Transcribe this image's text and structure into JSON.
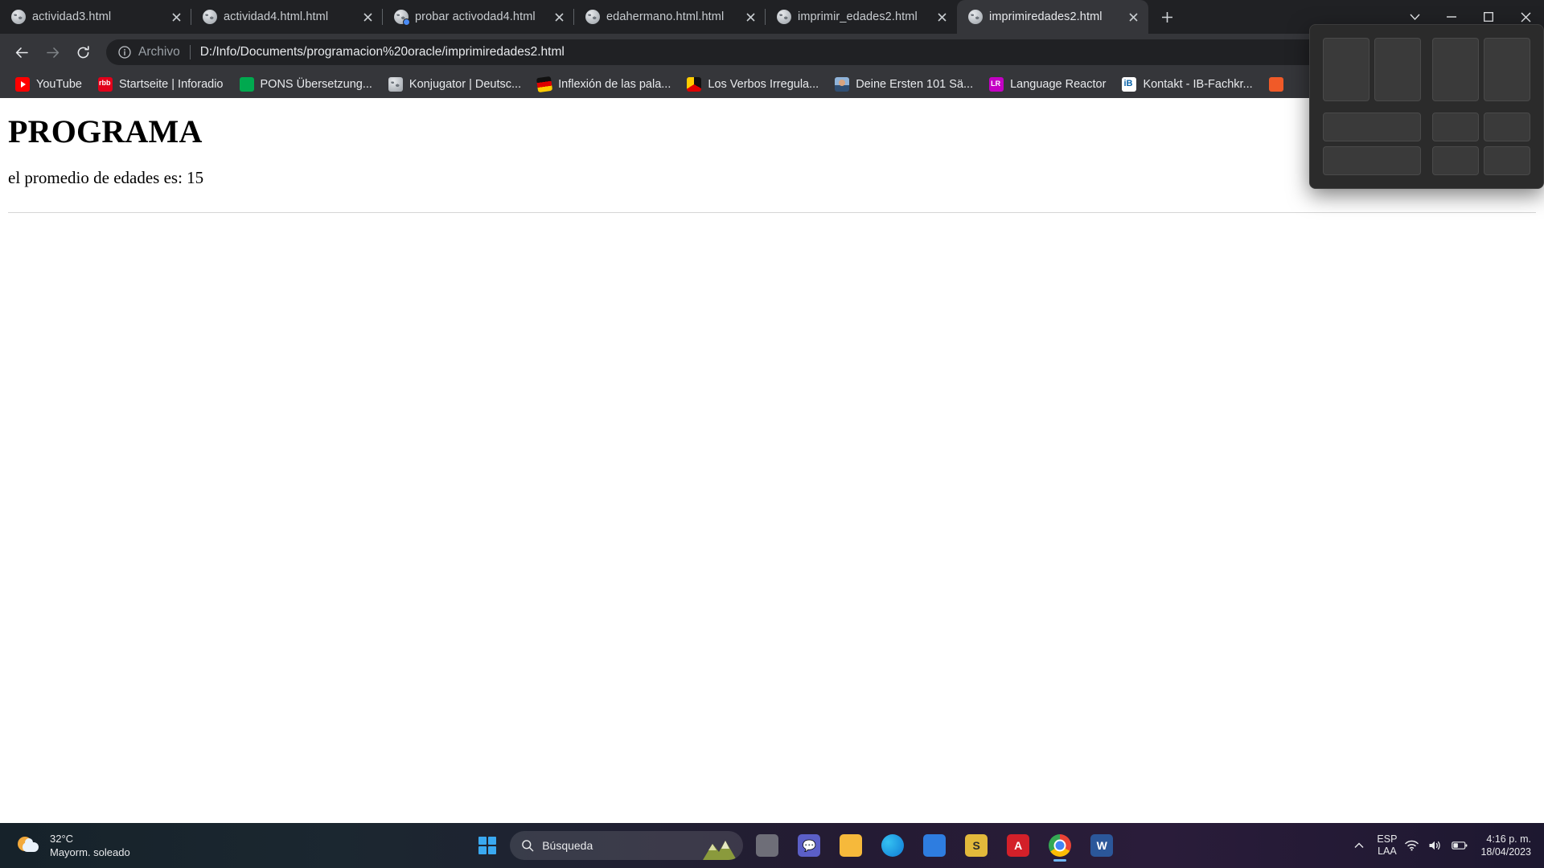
{
  "browser": {
    "tabs": [
      {
        "title": "actividad3.html",
        "icon": "globe-icon",
        "active": false,
        "loading": false
      },
      {
        "title": "actividad4.html.html",
        "icon": "globe-icon",
        "active": false,
        "loading": false
      },
      {
        "title": "probar activodad4.html",
        "icon": "globe-icon",
        "active": false,
        "loading": true
      },
      {
        "title": "edahermano.html.html",
        "icon": "globe-icon",
        "active": false,
        "loading": false
      },
      {
        "title": "imprimir_edades2.html",
        "icon": "globe-icon",
        "active": false,
        "loading": false
      },
      {
        "title": "imprimiredades2.html",
        "icon": "globe-icon",
        "active": true,
        "loading": false
      }
    ],
    "new_tab_tooltip": "+",
    "window_controls": {
      "minimize": "–",
      "maximize": "□",
      "close": "✕",
      "collapse": "⌄"
    },
    "toolbar": {
      "back": "back-arrow",
      "forward": "forward-arrow",
      "reload": "reload",
      "scheme_label": "Archivo",
      "url": "D:/Info/Documents/programacion%20oracle/imprimiredades2.html"
    },
    "bookmarks": [
      {
        "label": "YouTube",
        "icon": "youtube-icon"
      },
      {
        "label": "Startseite | Inforadio",
        "icon": "rbb-icon"
      },
      {
        "label": "PONS Übersetzung...",
        "icon": "pons-icon"
      },
      {
        "label": "Konjugator | Deutsc...",
        "icon": "globe-icon"
      },
      {
        "label": "Inflexión de las pala...",
        "icon": "german-flag-icon"
      },
      {
        "label": "Los Verbos Irregula...",
        "icon": "german-circle-icon"
      },
      {
        "label": "Deine Ersten 101 Sä...",
        "icon": "photo-icon"
      },
      {
        "label": "Language Reactor",
        "icon": "language-reactor-icon"
      },
      {
        "label": "Kontakt - IB-Fachkr...",
        "icon": "ib-icon"
      },
      {
        "label": "",
        "icon": "orange-circle-icon"
      }
    ]
  },
  "page": {
    "heading": "PROGRAMA",
    "paragraph": "el promedio de edades es: 15"
  },
  "snap_layout": {
    "name": "snap-layout-flyout",
    "options": [
      "two-column",
      "two-column-equal",
      "three-column-left-large",
      "four-quadrant"
    ]
  },
  "taskbar": {
    "weather": {
      "temperature": "32°C",
      "condition": "Mayorm. soleado"
    },
    "start_label": "Inicio",
    "search": {
      "placeholder": "Búsqueda",
      "value": ""
    },
    "apps": [
      {
        "name": "task-view",
        "label": "▭"
      },
      {
        "name": "teams-chat",
        "label": "💬"
      },
      {
        "name": "file-explorer",
        "label": "📁"
      },
      {
        "name": "microsoft-edge",
        "label": "e"
      },
      {
        "name": "microsoft-store",
        "label": "🛎"
      },
      {
        "name": "sublime-text",
        "label": "S"
      },
      {
        "name": "adobe-acrobat",
        "label": "A"
      },
      {
        "name": "google-chrome",
        "label": "C"
      },
      {
        "name": "microsoft-word",
        "label": "W"
      }
    ],
    "tray": {
      "overflow": "⌃",
      "language_line1": "ESP",
      "language_line2": "LAA",
      "network": "wifi-icon",
      "volume": "volume-icon",
      "battery": "battery-icon",
      "time": "4:16 p. m.",
      "date": "18/04/2023"
    }
  },
  "colors": {
    "tabstrip_bg": "#202124",
    "toolbar_bg": "#35363a",
    "omnibox_bg": "#202124",
    "text_primary": "#e8eaed",
    "accent_blue": "#3aa9f0"
  }
}
